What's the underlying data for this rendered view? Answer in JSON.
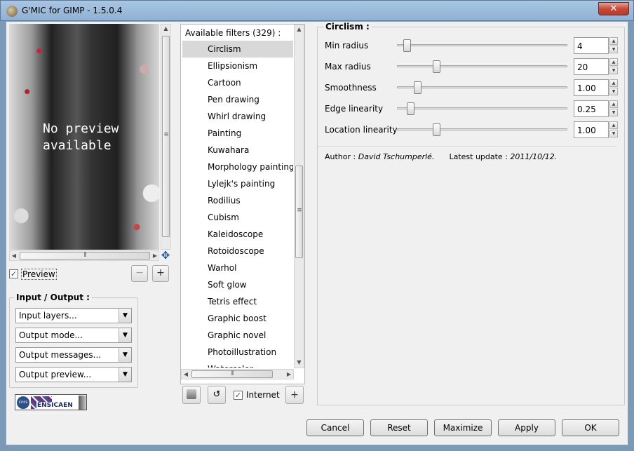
{
  "window": {
    "title": "G'MIC for GIMP - 1.5.0.4",
    "close_glyph": "✕"
  },
  "preview": {
    "message": "No preview\navailable",
    "checkbox_label": "Preview",
    "checked": true,
    "zoom_out": "−",
    "zoom_in": "+"
  },
  "io": {
    "title": "Input / Output :",
    "combos": [
      {
        "label": "Input layers..."
      },
      {
        "label": "Output mode..."
      },
      {
        "label": "Output messages..."
      },
      {
        "label": "Output preview..."
      }
    ]
  },
  "filters": {
    "header": "Available filters (329) :",
    "items": [
      "Circlism",
      "Ellipsionism",
      "Cartoon",
      "Pen drawing",
      "Whirl drawing",
      "Painting",
      "Kuwahara",
      "Morphology painting",
      "Lylejk's painting",
      "Rodilius",
      "Cubism",
      "Kaleidoscope",
      "Rotoidoscope",
      "Warhol",
      "Soft glow",
      "Tetris effect",
      "Graphic boost",
      "Graphic novel",
      "Photoillustration",
      "Watercolor"
    ],
    "selected_index": 0,
    "internet_label": "Internet",
    "internet_checked": true,
    "add_button": "+"
  },
  "params": {
    "title": "Circlism :",
    "items": [
      {
        "label": "Min radius",
        "value": "4",
        "fraction": 0.03
      },
      {
        "label": "Max radius",
        "value": "20",
        "fraction": 0.2
      },
      {
        "label": "Smoothness",
        "value": "1.00",
        "fraction": 0.09
      },
      {
        "label": "Edge linearity",
        "value": "0.25",
        "fraction": 0.05
      },
      {
        "label": "Location linearity",
        "value": "1.00",
        "fraction": 0.2
      }
    ],
    "author_label": "Author :",
    "author_name": "David Tschumperlé.",
    "update_label": "Latest update :",
    "update_date": "2011/10/12."
  },
  "buttons": {
    "cancel": "Cancel",
    "reset": "Reset",
    "maximize": "Maximize",
    "apply": "Apply",
    "ok": "OK"
  },
  "logo": {
    "cnrs": "cnrs",
    "ensicaen": "ENSICAEN"
  }
}
